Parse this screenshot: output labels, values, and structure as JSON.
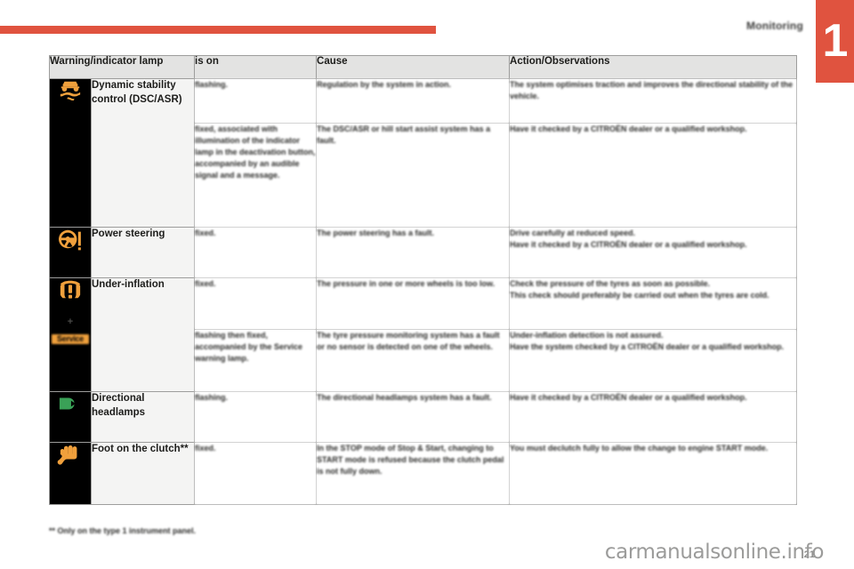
{
  "page": {
    "section_title": "Monitoring",
    "chapter_number": "1",
    "page_number": "21",
    "watermark": "carmanualsonline.info",
    "footnote": "** Only on the type 1 instrument panel.",
    "accent_color": "#e0533f",
    "header_bg": "#e3e3e2",
    "icon_bg": "#000000",
    "icon_amber": "#f0a03c",
    "icon_green": "#3aa157"
  },
  "table": {
    "columns": [
      {
        "key": "lamp",
        "label": "Warning/indicator lamp"
      },
      {
        "key": "is_on",
        "label": "is on"
      },
      {
        "key": "cause",
        "label": "Cause"
      },
      {
        "key": "action",
        "label": "Action/Observations"
      }
    ],
    "rows": [
      {
        "icon": "dsc-asr-skid-car-icon",
        "icon_color": "#f0a03c",
        "name": "Dynamic stability control (DSC/ASR)",
        "subrows": [
          {
            "is_on": "flashing.",
            "cause": "Regulation by the system in action.",
            "action": "The system optimises traction and improves the directional stability of the vehicle."
          },
          {
            "is_on": "fixed, associated with illumination of the indicator lamp in the deactivation button, accompanied by an audible signal and a message.",
            "cause": "The DSC/ASR or hill start assist system has a fault.",
            "action": "Have it checked by a CITROËN dealer or a qualified workshop."
          }
        ]
      },
      {
        "icon": "power-steering-wheel-icon",
        "icon_color": "#f0a03c",
        "name": "Power steering",
        "subrows": [
          {
            "is_on": "fixed.",
            "cause": "The power steering has a fault.",
            "action": "Drive carefully at reduced speed.\nHave it checked by a CITROËN dealer or a qualified workshop."
          }
        ]
      },
      {
        "icon": "tyre-under-inflation-icon",
        "icon_color": "#f0a03c",
        "icon_extra": {
          "plus": "+",
          "service_label": "Service"
        },
        "name": "Under-inflation",
        "subrows": [
          {
            "is_on": "fixed.",
            "cause": "The pressure in one or more wheels is too low.",
            "action": "Check the pressure of the tyres as soon as possible.\nThis check should preferably be carried out when the tyres are cold."
          },
          {
            "is_on": "flashing then fixed, accompanied by the Service warning lamp.",
            "cause": "The tyre pressure monitoring system has a fault or no sensor is detected on one of the wheels.",
            "action": "Under-inflation detection is not assured.\nHave the system checked by a CITROËN dealer or a qualified workshop."
          }
        ]
      },
      {
        "icon": "directional-headlamps-icon",
        "icon_color": "#3aa157",
        "name": "Directional headlamps",
        "subrows": [
          {
            "is_on": "flashing.",
            "cause": "The directional headlamps system has a fault.",
            "action": "Have it checked by a CITROËN dealer or a qualified workshop."
          }
        ]
      },
      {
        "icon": "foot-on-clutch-icon",
        "icon_color": "#f0a03c",
        "name": "Foot on the clutch**",
        "subrows": [
          {
            "is_on": "fixed.",
            "cause": "In the STOP mode of Stop & Start, changing to START mode is refused because the clutch pedal is not fully down.",
            "action": "You must declutch fully to allow the change to engine START mode."
          }
        ]
      }
    ]
  }
}
